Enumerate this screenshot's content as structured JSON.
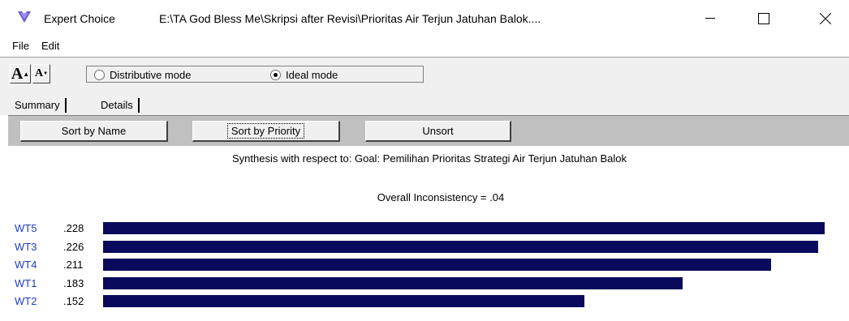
{
  "window": {
    "app_name": "Expert Choice",
    "path": "E:\\TA God Bless Me\\Skripsi after Revisi\\Prioritas Air Terjun Jatuhan Balok....",
    "icon": "expert-choice-logo-icon"
  },
  "menu": {
    "file": "File",
    "edit": "Edit"
  },
  "toolbar": {
    "font_increase": "A",
    "font_decrease": "A",
    "mode_distributive": "Distributive mode",
    "mode_ideal": "Ideal mode",
    "selected_mode": "ideal"
  },
  "tabs": {
    "summary": "Summary",
    "details": "Details"
  },
  "sort": {
    "by_name": "Sort by Name",
    "by_priority": "Sort by Priority",
    "unsort": "Unsort"
  },
  "synthesis_title": "Synthesis with respect to: Goal: Pemilihan Prioritas Strategi Air Terjun Jatuhan Balok",
  "inconsistency": "Overall Inconsistency = .04",
  "chart_data": {
    "type": "bar",
    "orientation": "horizontal",
    "categories": [
      "WT5",
      "WT3",
      "WT4",
      "WT1",
      "WT2"
    ],
    "values": [
      0.228,
      0.226,
      0.211,
      0.183,
      0.152
    ],
    "value_labels": [
      ".228",
      ".226",
      ".211",
      ".183",
      ".152"
    ],
    "bar_color": "#0a0a5c",
    "label_color": "#1e3cc8"
  }
}
